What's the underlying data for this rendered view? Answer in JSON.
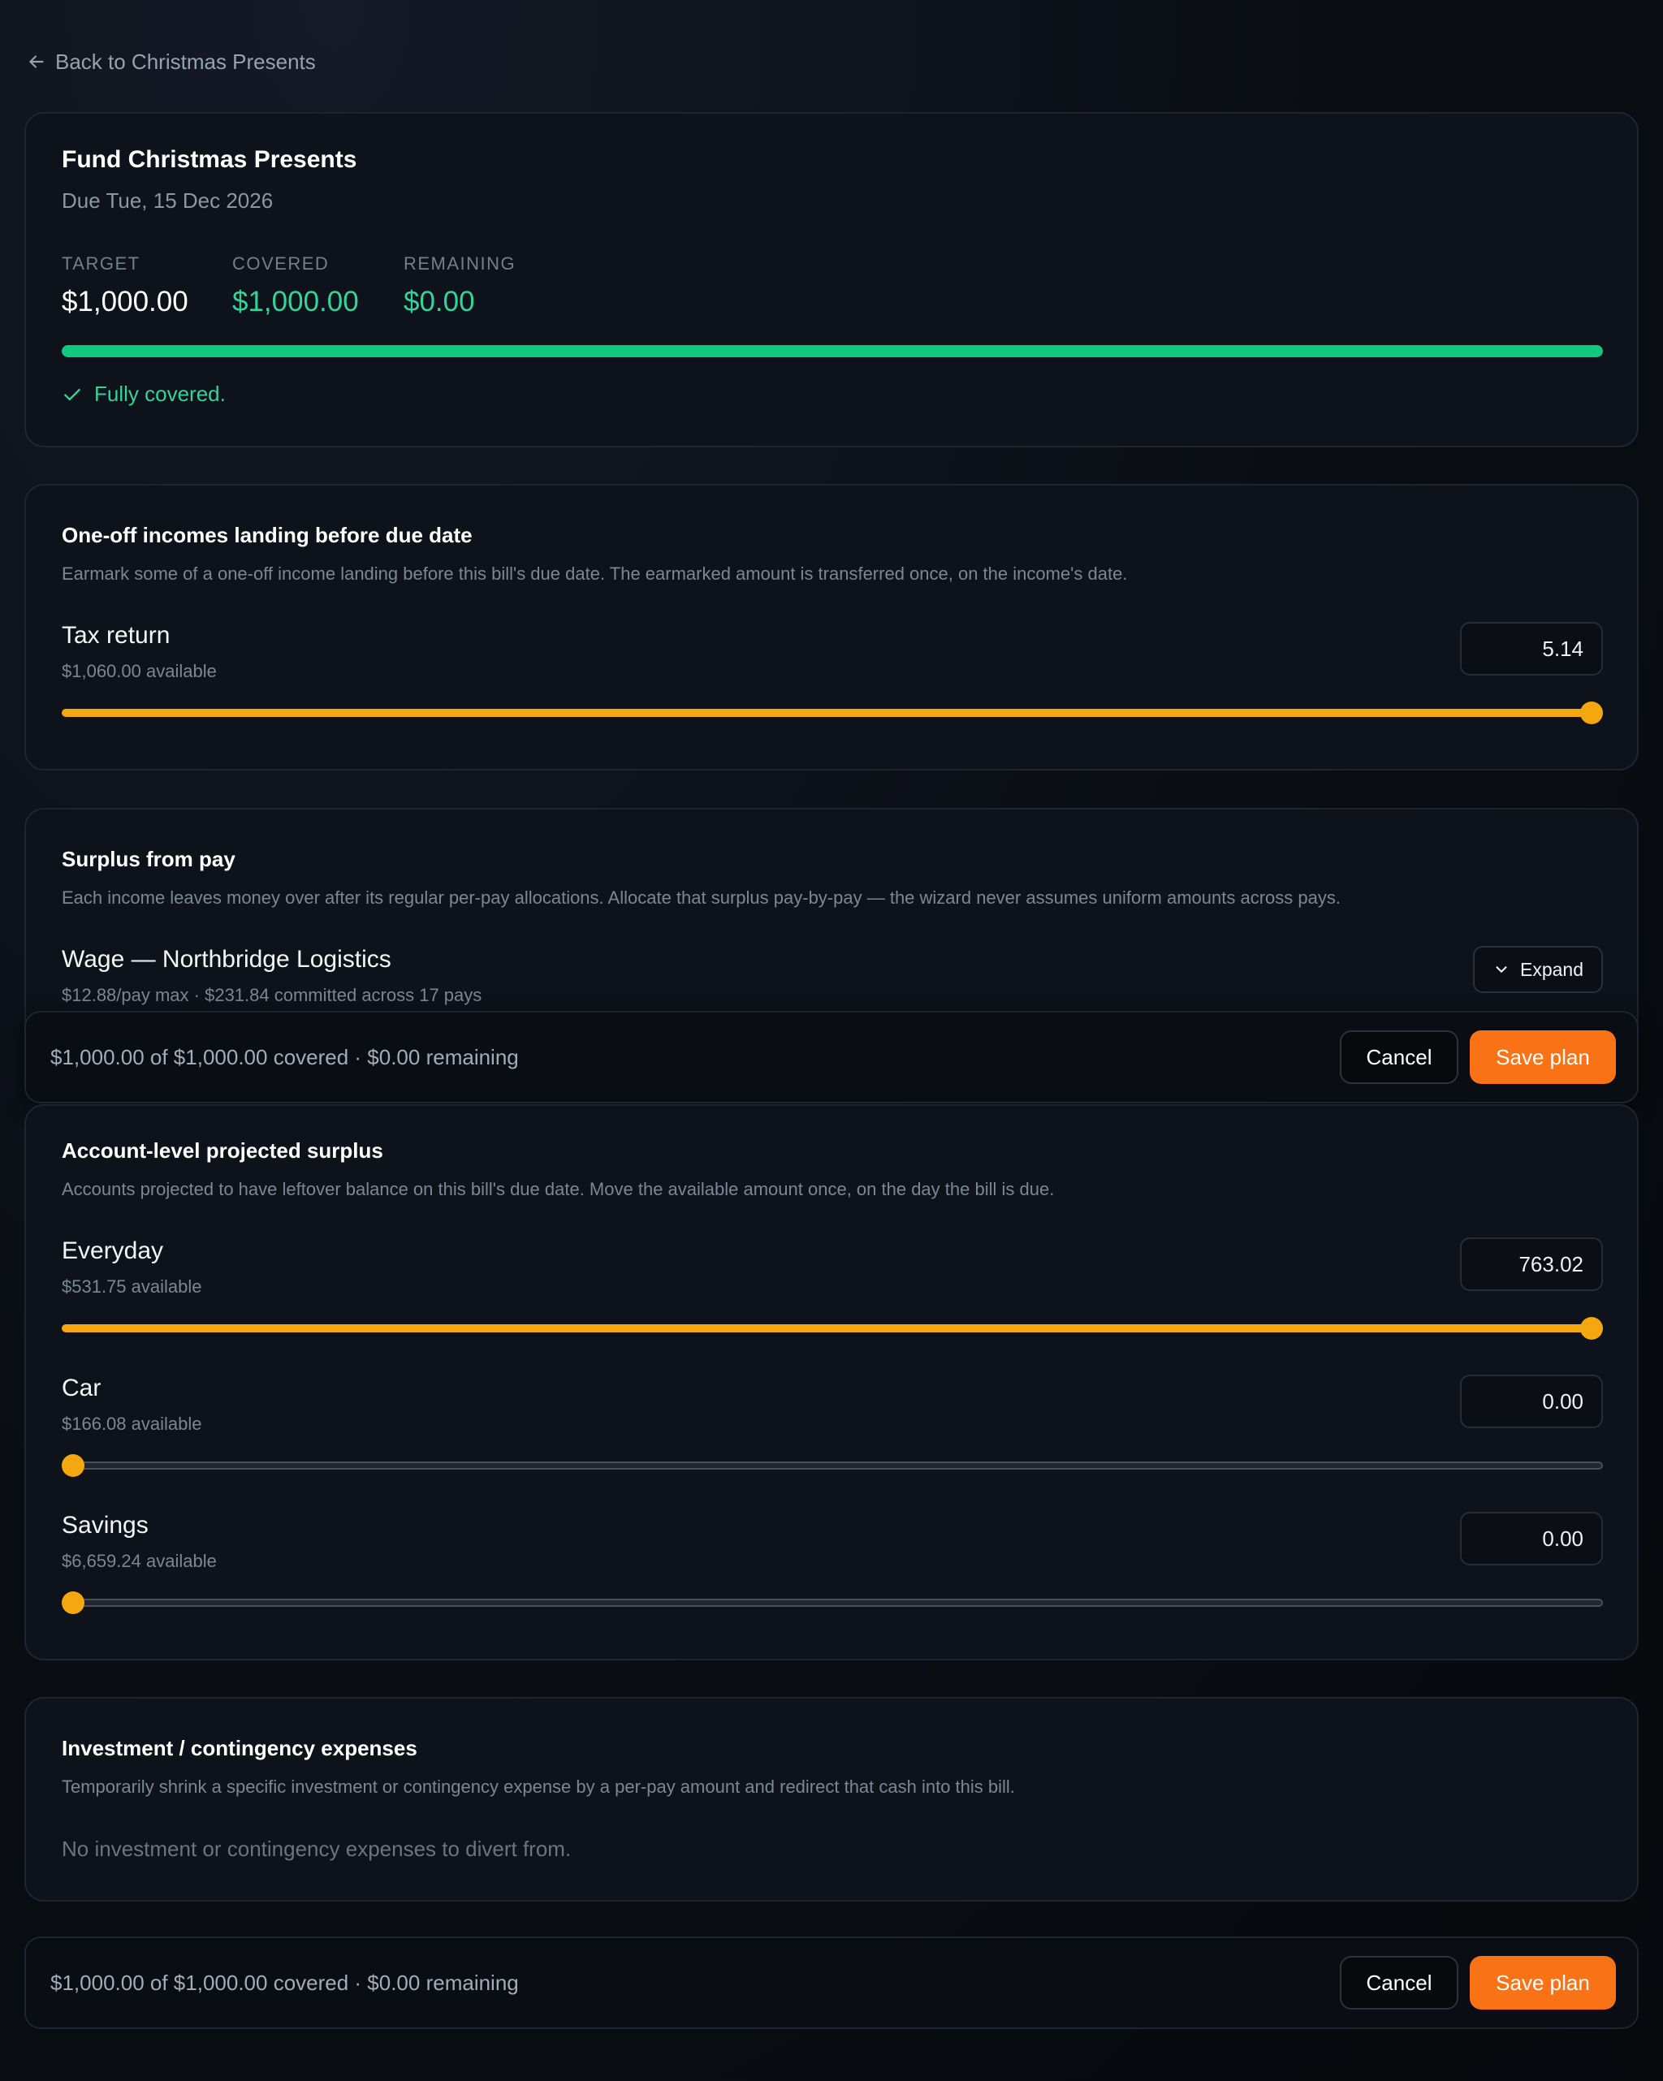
{
  "back_link": {
    "label": "Back to Christmas Presents",
    "icon": "arrow-left-icon"
  },
  "summary": {
    "title": "Fund Christmas Presents",
    "due": "Due Tue, 15 Dec 2026",
    "target": {
      "label": "TARGET",
      "value": "$1,000.00"
    },
    "covered": {
      "label": "COVERED",
      "value": "$1,000.00"
    },
    "remaining": {
      "label": "REMAINING",
      "value": "$0.00"
    },
    "progress_fraction": 1.0,
    "status": "Fully covered.",
    "colors": {
      "progress": "#10c97f",
      "positive": "#34d399"
    }
  },
  "oneoff": {
    "title": "One-off incomes landing before due date",
    "description": "Earmark some of a one-off income landing before this bill's due date. The earmarked amount is transferred once, on the income's date.",
    "items": [
      {
        "name": "Tax return",
        "available": "$1,060.00 available",
        "value": "5.14",
        "slider_fraction": 1.0
      }
    ]
  },
  "surplus": {
    "title": "Surplus from pay",
    "description": "Each income leaves money over after its regular per-pay allocations. Allocate that surplus pay-by-pay — the wizard never assumes uniform amounts across pays.",
    "income": {
      "name": "Wage — Northbridge Logistics",
      "detail": "$12.88/pay max · $231.84 committed across 17 pays",
      "expand_label": "Expand"
    }
  },
  "sticky_bar": {
    "summary": "$1,000.00 of $1,000.00 covered · $0.00 remaining",
    "cancel_label": "Cancel",
    "save_label": "Save plan"
  },
  "account": {
    "title": "Account-level projected surplus",
    "description": "Accounts projected to have leftover balance on this bill's due date. Move the available amount once, on the day the bill is due.",
    "items": [
      {
        "name": "Everyday",
        "available": "$531.75 available",
        "value": "763.02",
        "slider_fraction": 1.0
      },
      {
        "name": "Car",
        "available": "$166.08 available",
        "value": "0.00",
        "slider_fraction": 0.0
      },
      {
        "name": "Savings",
        "available": "$6,659.24 available",
        "value": "0.00",
        "slider_fraction": 0.0
      }
    ]
  },
  "invest": {
    "title": "Investment / contingency expenses",
    "description": "Temporarily shrink a specific investment or contingency expense by a per-pay amount and redirect that cash into this bill.",
    "empty": "No investment or contingency expenses to divert from."
  },
  "footer_bar": {
    "summary": "$1,000.00 of $1,000.00 covered · $0.00 remaining",
    "cancel_label": "Cancel",
    "save_label": "Save plan"
  },
  "accent_colors": {
    "slider": "#f5a70f",
    "save_button": "#f97316"
  }
}
